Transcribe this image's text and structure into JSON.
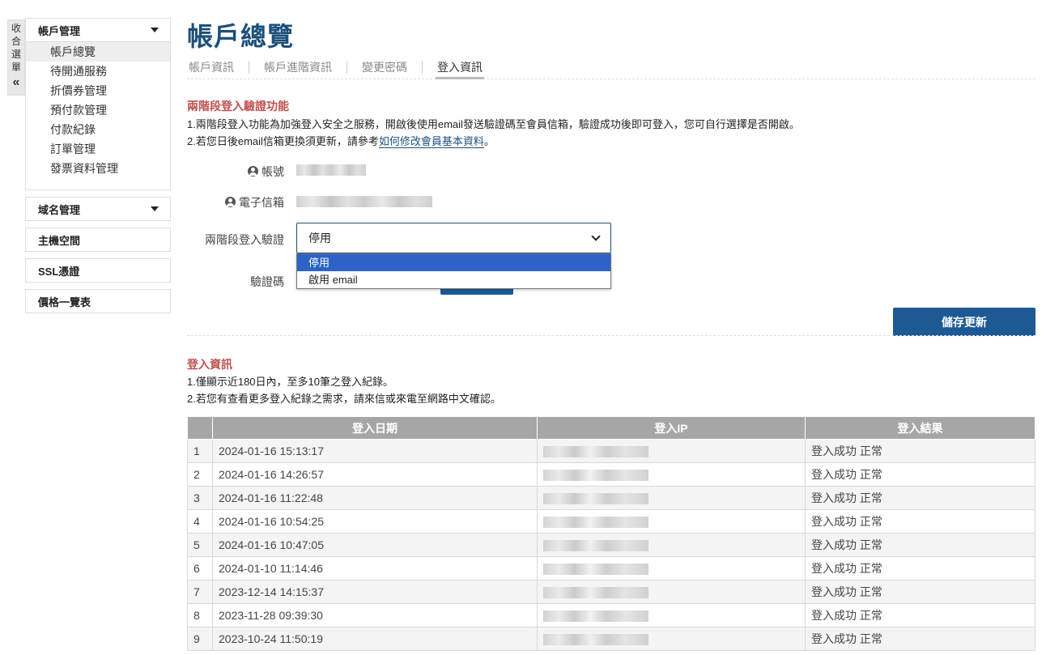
{
  "collapse": {
    "chars": [
      "收",
      "合",
      "選",
      "單"
    ],
    "chevron": "«"
  },
  "sidebar": {
    "account": {
      "label": "帳戶管理",
      "items": [
        {
          "label": "帳戶總覽"
        },
        {
          "label": "待開通服務"
        },
        {
          "label": "折價券管理"
        },
        {
          "label": "預付款管理"
        },
        {
          "label": "付款紀錄"
        },
        {
          "label": "訂單管理"
        },
        {
          "label": "發票資料管理"
        }
      ]
    },
    "domain_label": "域名管理",
    "hosting_label": "主機空間",
    "ssl_label": "SSL憑證",
    "price_label": "價格一覽表"
  },
  "page": {
    "title": "帳戶總覽"
  },
  "tabs": [
    "帳戶資訊",
    "帳戶進階資訊",
    "變更密碼",
    "登入資訊"
  ],
  "twofa": {
    "title": "兩階段登入驗證功能",
    "note1": "1.兩階段登入功能為加強登入安全之服務，開啟後使用email發送驗證碼至會員信箱，驗證成功後即可登入，您可自行選擇是否開啟。",
    "note2_prefix": "2.若您日後email信箱更換須更新，請參考",
    "note2_link": "如何修改會員基本資料",
    "note2_suffix": "。",
    "account_label": "帳號",
    "email_label": "電子信箱",
    "select_label": "兩階段登入驗證",
    "select_value": "停用",
    "options": [
      "停用",
      "啟用 email"
    ],
    "code_label": "驗證碼",
    "save_label": "儲存更新"
  },
  "login_info": {
    "title": "登入資訊",
    "note1": "1.僅顯示近180日內，至多10筆之登入紀錄。",
    "note2": "2.若您有查看更多登入紀錄之需求，請來信或來電至網路中文確認。",
    "columns": [
      "",
      "登入日期",
      "登入IP",
      "登入結果"
    ],
    "rows": [
      {
        "n": "1",
        "date": "2024-01-16 15:13:17",
        "result": "登入成功 正常"
      },
      {
        "n": "2",
        "date": "2024-01-16 14:26:57",
        "result": "登入成功 正常"
      },
      {
        "n": "3",
        "date": "2024-01-16 11:22:48",
        "result": "登入成功 正常"
      },
      {
        "n": "4",
        "date": "2024-01-16 10:54:25",
        "result": "登入成功 正常"
      },
      {
        "n": "5",
        "date": "2024-01-16 10:47:05",
        "result": "登入成功 正常"
      },
      {
        "n": "6",
        "date": "2024-01-10 11:14:46",
        "result": "登入成功 正常"
      },
      {
        "n": "7",
        "date": "2023-12-14 14:15:37",
        "result": "登入成功 正常"
      },
      {
        "n": "8",
        "date": "2023-11-28 09:39:30",
        "result": "登入成功 正常"
      },
      {
        "n": "9",
        "date": "2023-10-24 11:50:19",
        "result": "登入成功 正常"
      }
    ]
  }
}
